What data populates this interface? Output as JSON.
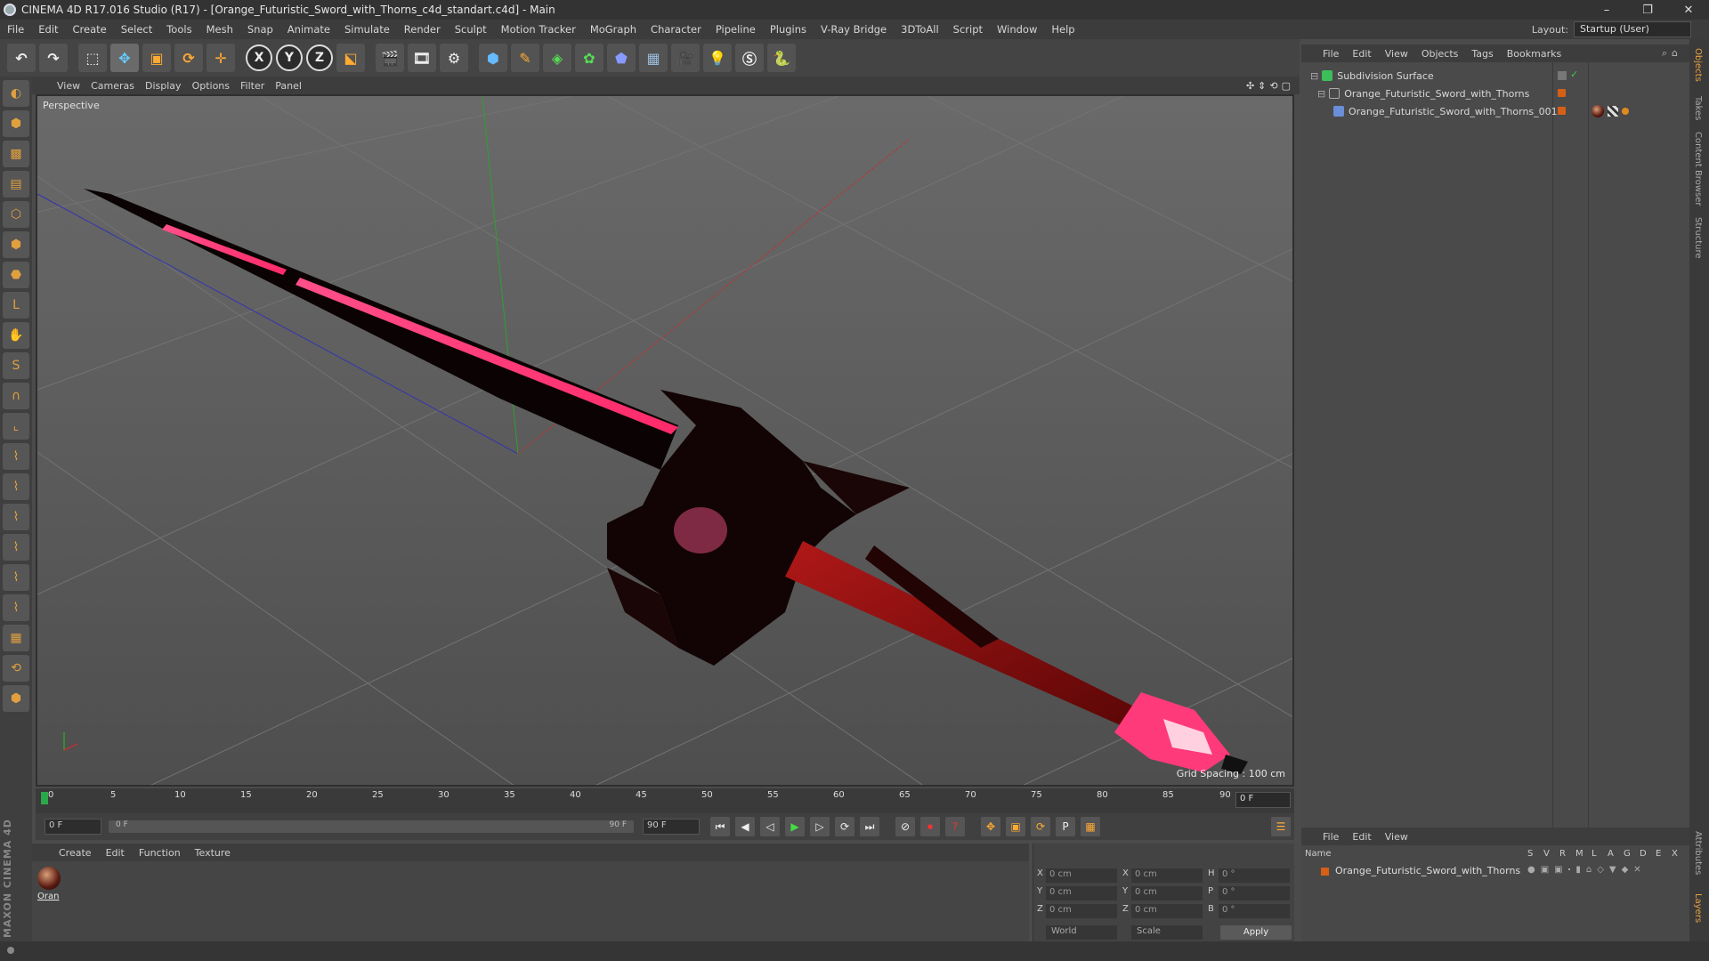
{
  "window": {
    "title": "CINEMA 4D R17.016 Studio (R17) - [Orange_Futuristic_Sword_with_Thorns_c4d_standart.c4d] - Main",
    "controls": [
      "–",
      "❐",
      "✕"
    ]
  },
  "menu": [
    "File",
    "Edit",
    "Create",
    "Select",
    "Tools",
    "Mesh",
    "Snap",
    "Animate",
    "Simulate",
    "Render",
    "Sculpt",
    "Motion Tracker",
    "MoGraph",
    "Character",
    "Pipeline",
    "Plugins",
    "V-Ray Bridge",
    "3DToAll",
    "Script",
    "Window",
    "Help"
  ],
  "layout": {
    "label": "Layout:",
    "value": "Startup (User)"
  },
  "toolbar": {
    "axis_x": "X",
    "axis_y": "Y",
    "axis_z": "Z"
  },
  "viewport": {
    "menu": [
      "View",
      "Cameras",
      "Display",
      "Options",
      "Filter",
      "Panel"
    ],
    "camera_label": "Perspective",
    "grid_spacing": "Grid Spacing : 100 cm",
    "nav_icons": "✣⇕⟲▢"
  },
  "timeline": {
    "ticks": [
      "0",
      "5",
      "10",
      "15",
      "20",
      "25",
      "30",
      "35",
      "40",
      "45",
      "50",
      "55",
      "60",
      "65",
      "70",
      "75",
      "80",
      "85",
      "90"
    ],
    "current_frame": "0 F",
    "start_field": "0 F",
    "range_start": "0 F",
    "range_end": "90 F",
    "end_field": "90 F"
  },
  "materials": {
    "menu": [
      "Create",
      "Edit",
      "Function",
      "Texture"
    ],
    "items": [
      {
        "name": "Oran"
      }
    ]
  },
  "coordinates": {
    "rows": [
      {
        "a1": "X",
        "v1": "0 cm",
        "a2": "X",
        "v2": "0 cm",
        "a3": "H",
        "v3": "0 °"
      },
      {
        "a1": "Y",
        "v1": "0 cm",
        "a2": "Y",
        "v2": "0 cm",
        "a3": "P",
        "v3": "0 °"
      },
      {
        "a1": "Z",
        "v1": "0 cm",
        "a2": "Z",
        "v2": "0 cm",
        "a3": "B",
        "v3": "0 °"
      }
    ],
    "mode_world": "World",
    "mode_scale": "Scale",
    "apply": "Apply"
  },
  "object_manager": {
    "menu": [
      "File",
      "Edit",
      "View",
      "Objects",
      "Tags",
      "Bookmarks"
    ],
    "objects": [
      {
        "name": "Subdivision Surface"
      },
      {
        "name": "Orange_Futuristic_Sword_with_Thorns"
      },
      {
        "name": "Orange_Futuristic_Sword_with_Thorns_001"
      }
    ]
  },
  "layer_manager": {
    "menu": [
      "File",
      "Edit",
      "View"
    ],
    "name_header": "Name",
    "columns": [
      "S",
      "V",
      "R",
      "M",
      "L",
      "A",
      "G",
      "D",
      "E",
      "X"
    ],
    "row_name": "Orange_Futuristic_Sword_with_Thorns"
  },
  "side_tabs": [
    "Objects",
    "Takes",
    "Content Browser",
    "Structure",
    "Attributes",
    "Layers"
  ],
  "branding": "MAXON CINEMA 4D",
  "colors": {
    "accent_orange": "#d65f18",
    "sword_glow": "#ff3a7a",
    "grid_line": "#6a6a6a",
    "axis_red": "#c23030",
    "axis_green": "#2fa02f",
    "axis_blue": "#3434b0"
  }
}
